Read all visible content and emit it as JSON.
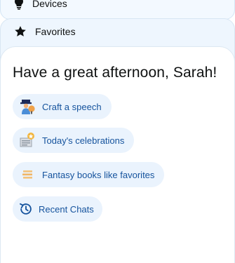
{
  "nav": {
    "devices_label": "Devices",
    "favorites_label": "Favorites"
  },
  "greeting": "Have a great afternoon, Sarah!",
  "suggestions": [
    {
      "label": "Craft a speech",
      "icon": "speech-icon"
    },
    {
      "label": "Today's celebrations",
      "icon": "celebration-icon"
    },
    {
      "label": "Fantasy books like favorites",
      "icon": "books-icon"
    }
  ],
  "recent_chats": {
    "label": "Recent Chats",
    "icon": "history-icon"
  },
  "colors": {
    "accent_text": "#15539d",
    "pill_bg": "#eaf3fd",
    "card_bg": "#eef6fe"
  }
}
